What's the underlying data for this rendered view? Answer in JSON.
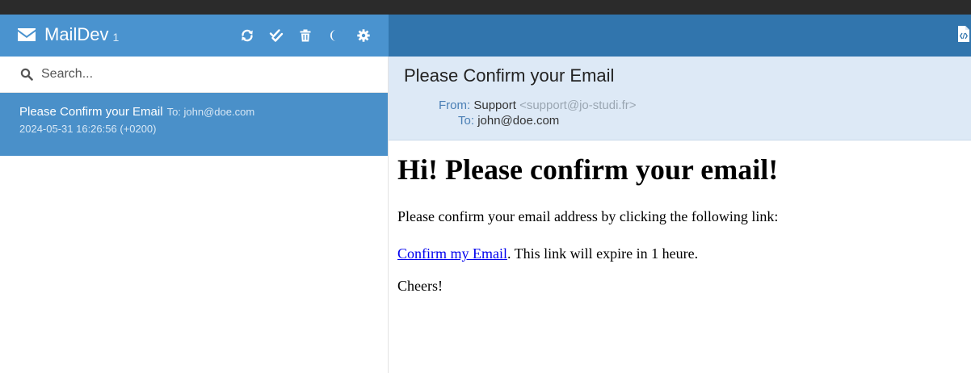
{
  "app": {
    "name": "MailDev",
    "unread_count": "1"
  },
  "toolbar": {
    "icons": [
      "refresh-icon",
      "mark-all-read-icon",
      "trash-icon",
      "moon-icon",
      "gear-icon"
    ]
  },
  "search": {
    "placeholder": "Search...",
    "value": ""
  },
  "messages": [
    {
      "subject": "Please Confirm your Email",
      "to": "To: john@doe.com",
      "date": "2024-05-31 16:26:56 (+0200)"
    }
  ],
  "email": {
    "subject": "Please Confirm your Email",
    "from_label": "From:",
    "from_name": "Support",
    "from_address": "<support@jo-studi.fr>",
    "to_label": "To:",
    "to_value": "john@doe.com",
    "body": {
      "heading": "Hi! Please confirm your email!",
      "paragraph1": "Please confirm your email address by clicking the following link:",
      "link_text": "Confirm my Email",
      "paragraph2_rest": ". This link will expire in 1 heure.",
      "closing": "Cheers!"
    }
  },
  "colors": {
    "sidebar_header": "#4a93cf",
    "main_header": "#3175ad",
    "selected_item": "#4a90c9",
    "meta_background": "#dde9f6",
    "link": "#0000ee"
  }
}
